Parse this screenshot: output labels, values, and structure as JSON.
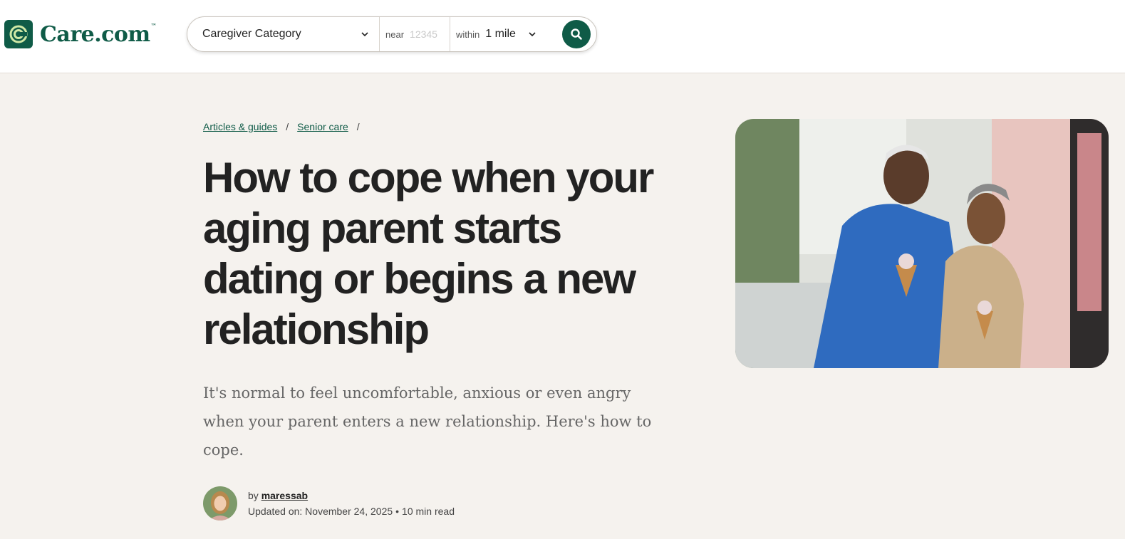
{
  "brand": {
    "name": "Care.com",
    "tm": "™",
    "color": "#0f5b47"
  },
  "search": {
    "category_value": "Caregiver Category",
    "near_label": "near",
    "near_placeholder": "12345",
    "within_label": "within",
    "within_value": "1 mile"
  },
  "breadcrumb": {
    "items": [
      {
        "label": "Articles & guides"
      },
      {
        "label": "Senior care"
      }
    ],
    "separator": "/"
  },
  "article": {
    "title": "How to cope when your aging parent starts dating or begins a new relationship",
    "subtitle": "It's normal to feel uncomfortable, anxious or even angry when your parent enters a new relationship. Here's how to cope.",
    "by_label": "by",
    "author": "maressab",
    "updated": "Updated on: November 24, 2025",
    "read_time": "10 min read",
    "meta_separator": "•"
  },
  "icons": [
    "care-logo-icon",
    "chevron-down-icon",
    "search-icon"
  ]
}
